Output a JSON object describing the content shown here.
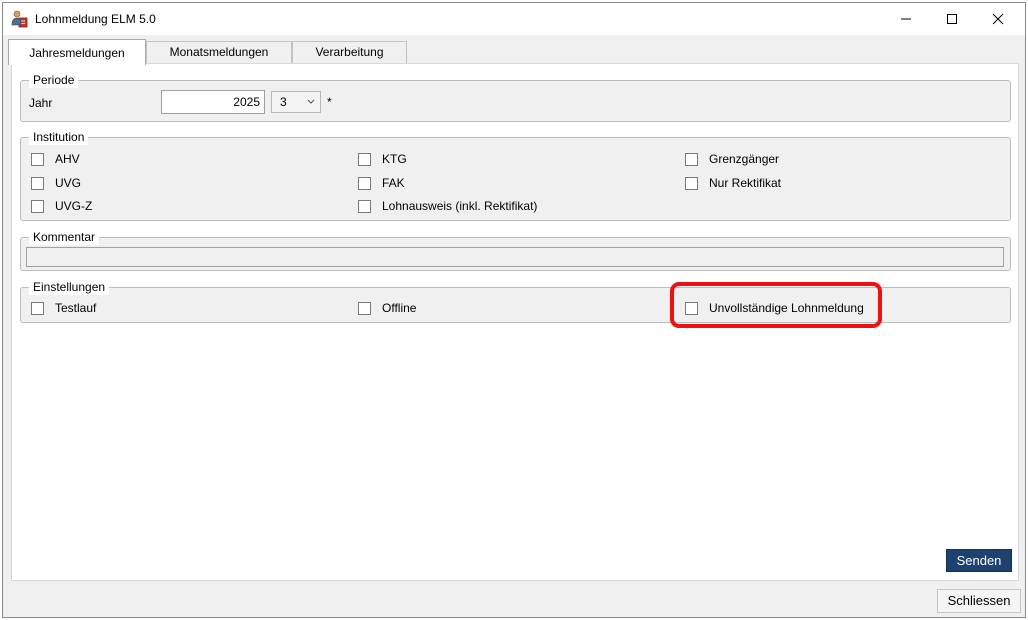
{
  "window": {
    "title": "Lohnmeldung ELM 5.0",
    "icon": "person-document-icon"
  },
  "tabs": [
    {
      "label": "Jahresmeldungen",
      "active": true
    },
    {
      "label": "Monatsmeldungen",
      "active": false
    },
    {
      "label": "Verarbeitung",
      "active": false
    }
  ],
  "periode": {
    "group_label": "Periode",
    "jahr_label": "Jahr",
    "jahr_value": "2025",
    "month_value": "3",
    "required_marker": "*"
  },
  "institution": {
    "group_label": "Institution",
    "items": [
      {
        "label": "AHV",
        "checked": false
      },
      {
        "label": "UVG",
        "checked": false
      },
      {
        "label": "UVG-Z",
        "checked": false
      },
      {
        "label": "KTG",
        "checked": false
      },
      {
        "label": "FAK",
        "checked": false
      },
      {
        "label": "Lohnausweis (inkl. Rektifikat)",
        "checked": false
      },
      {
        "label": "Grenzgänger",
        "checked": false
      },
      {
        "label": "Nur Rektifikat",
        "checked": false
      }
    ]
  },
  "kommentar": {
    "group_label": "Kommentar",
    "value": ""
  },
  "einstellungen": {
    "group_label": "Einstellungen",
    "items": [
      {
        "label": "Testlauf",
        "checked": false
      },
      {
        "label": "Offline",
        "checked": false
      },
      {
        "label": "Unvollständige Lohnmeldung",
        "checked": false
      }
    ]
  },
  "buttons": {
    "send": "Senden",
    "close": "Schliessen"
  },
  "colors": {
    "send_button": "#1e4170",
    "highlight": "#ee1111"
  }
}
